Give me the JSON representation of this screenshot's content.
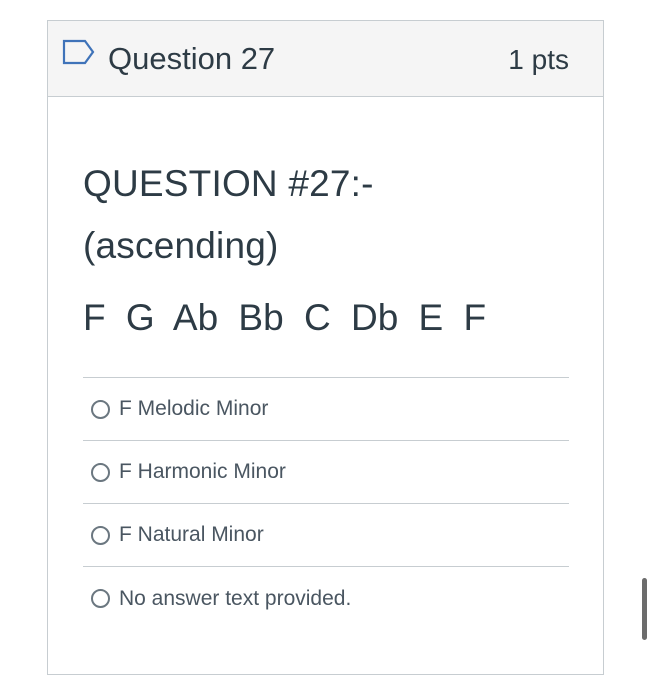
{
  "question": {
    "title": "Question 27",
    "points": "1 pts",
    "flag_icon": "flag-outline-icon",
    "text_line1": "QUESTION #27:-",
    "text_line2": "(ascending)",
    "notes": "F  G  Ab  Bb  C  Db  E  F"
  },
  "answers": [
    {
      "label": "F Melodic Minor"
    },
    {
      "label": "F Harmonic Minor"
    },
    {
      "label": "F Natural Minor"
    },
    {
      "label": "No answer text provided."
    }
  ],
  "colors": {
    "border": "#c7cdd1",
    "header_bg": "#f5f5f5",
    "text": "#2d3b45",
    "flag": "#3f73b9"
  }
}
